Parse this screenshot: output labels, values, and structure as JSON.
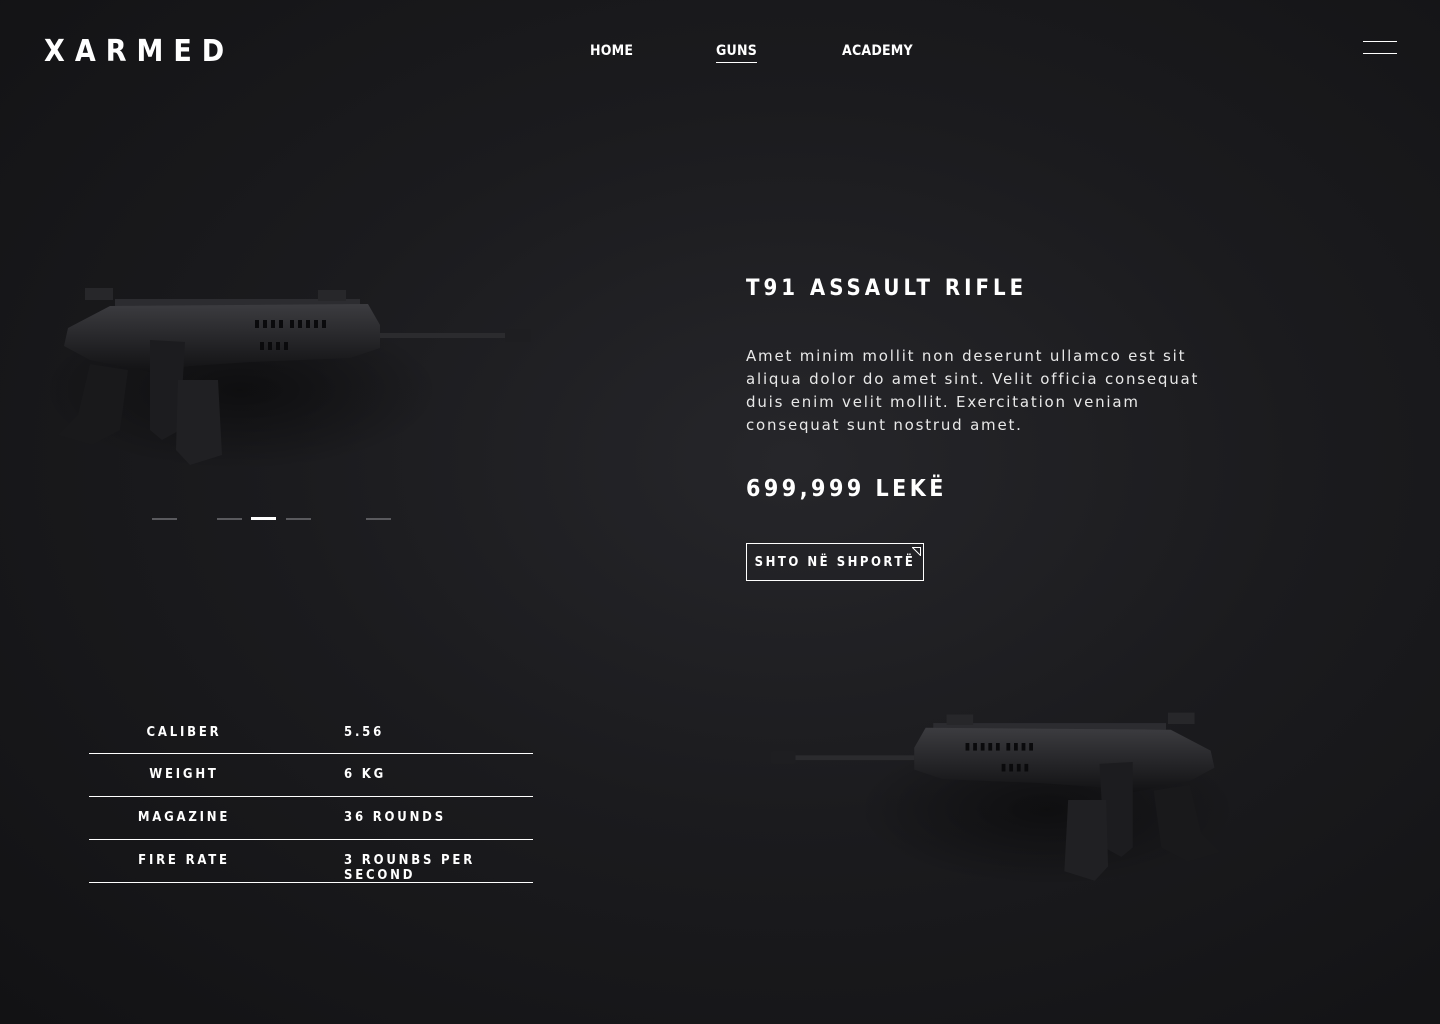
{
  "header": {
    "logo": "XARMED",
    "nav": [
      {
        "label": "HOME",
        "active": false
      },
      {
        "label": "GUNS",
        "active": true
      },
      {
        "label": "ACADEMY",
        "active": false
      }
    ],
    "menu_icon": "hamburger-menu-icon"
  },
  "product": {
    "title": "T91 ASSAULT RIFLE",
    "description": "Amet minim mollit non deserunt ullamco est sit aliqua dolor do amet sint. Velit officia consequat duis enim velit mollit. Exercitation veniam consequat sunt nostrud amet.",
    "price": "699,999 LEKË",
    "cart_button": "SHTO NË SHPORTË"
  },
  "carousel": {
    "slide_count": 5,
    "active_index": 2
  },
  "specs": [
    {
      "label": "CALIBER",
      "value": "5.56"
    },
    {
      "label": "WEIGHT",
      "value": "6 KG"
    },
    {
      "label": "MAGAZINE",
      "value": "36 ROUNDS"
    },
    {
      "label": "FIRE RATE",
      "value": "3 ROUNBS PER SECOND"
    }
  ],
  "colors": {
    "background": "#1b1b1e",
    "text": "#ffffff",
    "inactive_dot": "#5a5a5e"
  }
}
